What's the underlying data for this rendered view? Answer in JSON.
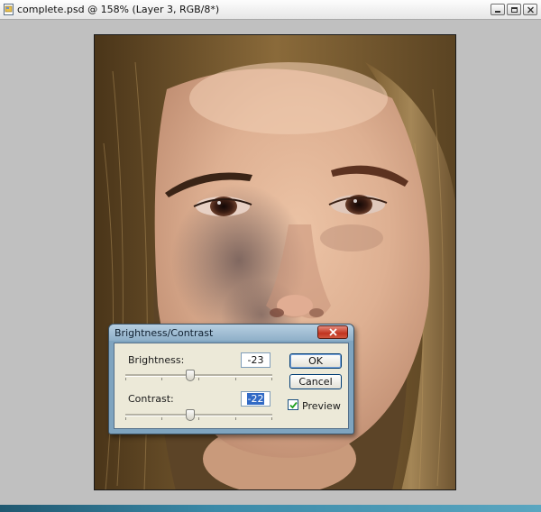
{
  "window": {
    "title": "complete.psd @ 158% (Layer 3, RGB/8*)",
    "controls": [
      "minimize-icon",
      "restore-icon",
      "close-icon"
    ]
  },
  "dialog": {
    "title": "Brightness/Contrast",
    "brightness": {
      "label": "Brightness:",
      "value": "-23",
      "slider_fraction": 0.44
    },
    "contrast": {
      "label": "Contrast:",
      "value": "-22",
      "slider_fraction": 0.44
    },
    "ok_label": "OK",
    "cancel_label": "Cancel",
    "preview_label": "Preview",
    "preview_checked": true
  },
  "colors": {
    "canvas_background": "#c0c0c0",
    "dialog_frame": "#7fa4bf",
    "dialog_body": "#ece9d8",
    "close_button": "#c2341f",
    "selection": "#316ac5"
  }
}
